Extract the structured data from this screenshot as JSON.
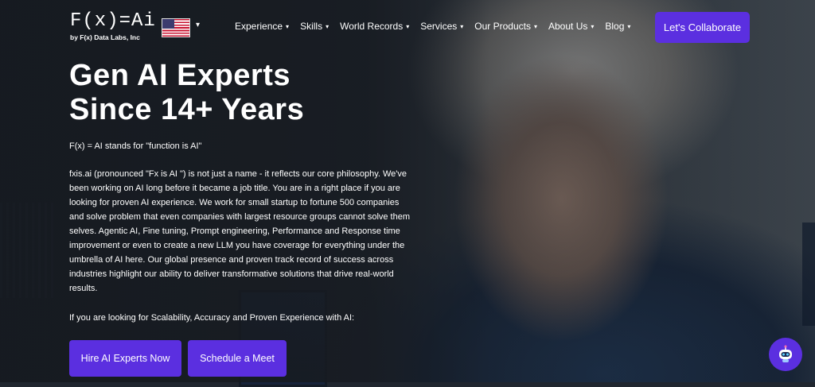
{
  "header": {
    "logo": {
      "main": "F(x)=Ai",
      "sub": "by F(x) Data Labs, Inc"
    },
    "language": {
      "icon": "us-flag-icon",
      "caret": "▾"
    },
    "nav": [
      {
        "label": "Experience",
        "caret": "▾"
      },
      {
        "label": "Skills",
        "caret": "▾"
      },
      {
        "label": "World Records",
        "caret": "▾"
      },
      {
        "label": "Services",
        "caret": "▾"
      },
      {
        "label": "Our Products",
        "caret": "▾"
      },
      {
        "label": "About Us",
        "caret": "▾"
      },
      {
        "label": "Blog",
        "caret": "▾"
      }
    ],
    "cta": "Let's Collaborate"
  },
  "hero": {
    "title_line1": "Gen AI Experts",
    "title_line2": "Since 14+ Years",
    "tagline": "F(x) = AI stands for \"function is AI\"",
    "paragraph": "fxis.ai (pronounced \"Fx is AI \") is not just a name - it reflects our core philosophy. We've been working on AI long before it became a job title. You are in a right place if you are looking for proven AI experience. We work for small startup to fortune 500 companies and solve problem that even companies with largest resource groups cannot solve them selves. Agentic AI, Fine tuning, Prompt engineering, Performance and Response time improvement or even to create a new LLM you have coverage for everything under the umbrella of AI here. Our global presence and proven track record of success across industries highlight our ability to deliver transformative solutions that drive real-world results.",
    "question": "If you are looking for Scalability, Accuracy and Proven Experience with AI:",
    "buttons": {
      "hire": "Hire AI Experts Now",
      "meet": "Schedule a Meet"
    }
  },
  "widgets": {
    "chat_bot_icon": "robot-icon"
  },
  "colors": {
    "accent": "#5b2fe0"
  }
}
